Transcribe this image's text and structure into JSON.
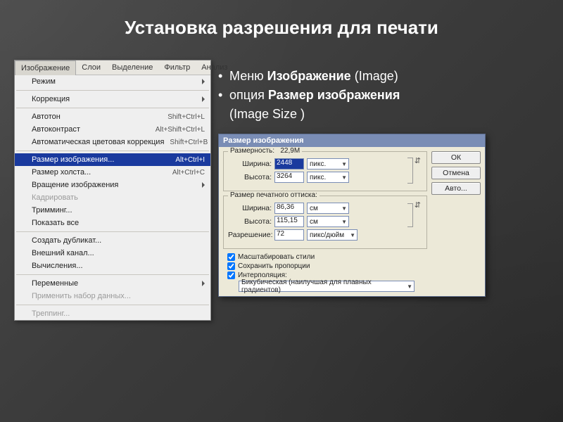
{
  "slide_title": "Установка разрешения для печати",
  "bullets": {
    "b1_pre": "Меню ",
    "b1_strong": "Изображение",
    "b1_post": " (Image)",
    "b2_pre": " опция ",
    "b2_strong": "Размер изображения",
    "b2_post2": " (Image Size )"
  },
  "menubar": {
    "active": "Изображение",
    "items": [
      "Слои",
      "Выделение",
      "Фильтр",
      "Анализ"
    ]
  },
  "menu": [
    {
      "label": "Режим",
      "sub": true
    },
    {
      "sep": true
    },
    {
      "label": "Коррекция",
      "sub": true
    },
    {
      "sep": true
    },
    {
      "label": "Автотон",
      "shortcut": "Shift+Ctrl+L"
    },
    {
      "label": "Автоконтраст",
      "shortcut": "Alt+Shift+Ctrl+L"
    },
    {
      "label": "Автоматическая цветовая коррекция",
      "shortcut": "Shift+Ctrl+B"
    },
    {
      "sep": true
    },
    {
      "label": "Размер изображения...",
      "shortcut": "Alt+Ctrl+I",
      "selected": true
    },
    {
      "label": "Размер холста...",
      "shortcut": "Alt+Ctrl+C"
    },
    {
      "label": "Вращение изображения",
      "sub": true
    },
    {
      "label": "Кадрировать",
      "disabled": true
    },
    {
      "label": "Тримминг..."
    },
    {
      "label": "Показать все"
    },
    {
      "sep": true
    },
    {
      "label": "Создать дубликат..."
    },
    {
      "label": "Внешний канал..."
    },
    {
      "label": "Вычисления..."
    },
    {
      "sep": true
    },
    {
      "label": "Переменные",
      "sub": true
    },
    {
      "label": "Применить набор данных...",
      "disabled": true
    },
    {
      "sep": true
    },
    {
      "label": "Треппинг...",
      "disabled": true
    }
  ],
  "dialog": {
    "title": "Размер изображения",
    "dims_label": "Размерность:",
    "dims_value": "22,9M",
    "group1": "Размер печатного оттиска:",
    "width_label": "Ширина:",
    "height_label": "Высота:",
    "res_label": "Разрешение:",
    "px_width": "2448",
    "px_height": "3264",
    "px_unit": "пикс.",
    "print_width": "86,36",
    "print_height": "115,15",
    "print_unit": "см",
    "res_value": "72",
    "res_unit": "пикс/дюйм",
    "chk_scale": "Масштабировать стили",
    "chk_prop": "Сохранить пропорции",
    "chk_interp": "Интерполяция:",
    "interp_value": "Бикубическая (наилучшая для плавных градиентов)",
    "btn_ok": "ОК",
    "btn_cancel": "Отмена",
    "btn_auto": "Авто..."
  }
}
